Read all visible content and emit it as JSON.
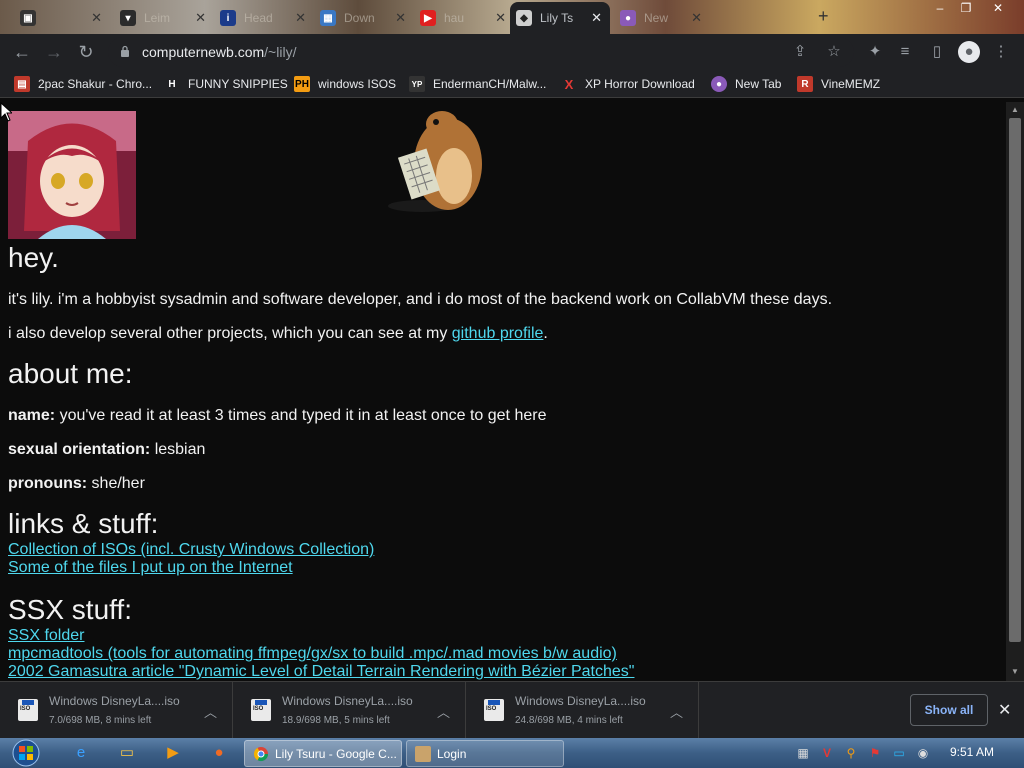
{
  "browser": {
    "tabs": [
      {
        "label": "",
        "favicon_text": "",
        "favicon_color": "#333333",
        "active": false
      },
      {
        "label": "Leim",
        "favicon_text": "",
        "favicon_color": "#2b2b2b",
        "active": false
      },
      {
        "label": "Head",
        "favicon_text": "i",
        "favicon_color": "#1b3b8a",
        "active": false
      },
      {
        "label": "Down",
        "favicon_text": "",
        "favicon_color": "#3a78c4",
        "active": false
      },
      {
        "label": "hau",
        "favicon_text": "▶",
        "favicon_color": "#e02020",
        "active": false
      },
      {
        "label": "Lily Ts",
        "favicon_text": "",
        "favicon_color": "#cfcfcf",
        "active": true
      },
      {
        "label": "New",
        "favicon_text": "",
        "favicon_color": "#8a5ab8",
        "active": false
      }
    ],
    "url_host": "computernewb.com",
    "url_path": "/~lily/"
  },
  "bookmarks": [
    {
      "label": "2pac Shakur - Chro...",
      "icon": "bookmark-2pac-icon",
      "icon_text": "",
      "icon_color": "#c0392b"
    },
    {
      "label": "FUNNY SNIPPIES",
      "icon": "letter-h-icon",
      "icon_text": "H",
      "icon_color": "#202124"
    },
    {
      "label": "windows ISOS",
      "icon": "ph-icon",
      "icon_text": "PH",
      "icon_color": "#f39c12"
    },
    {
      "label": "EndermanCH/Malw...",
      "icon": "yp-icon",
      "icon_text": "YP",
      "icon_color": "#333333"
    },
    {
      "label": "XP Horror Download",
      "icon": "x-icon",
      "icon_text": "X",
      "icon_color": "#202124"
    },
    {
      "label": "New Tab",
      "icon": "newtab-icon",
      "icon_text": "",
      "icon_color": "#8a5ab8"
    },
    {
      "label": "VineMEMZ",
      "icon": "r-icon",
      "icon_text": "R",
      "icon_color": "#c0392b"
    }
  ],
  "page": {
    "greeting": "hey.",
    "intro": "it's lily. i'm a hobbyist sysadmin and software developer, and i do most of the backend work on CollabVM these days.",
    "projects_prefix": "i also develop several other projects, which you can see at my ",
    "projects_link": "github profile",
    "projects_suffix": ".",
    "about_heading": "about me:",
    "name_label": "name:",
    "name_value": " you've read it at least 3 times and typed it in at least once to get here",
    "orientation_label": "sexual orientation:",
    "orientation_value": " lesbian",
    "pronouns_label": "pronouns:",
    "pronouns_value": " she/her",
    "links_heading": "links & stuff:",
    "links": [
      "Collection of ISOs (incl. Crusty Windows Collection)",
      "Some of the files I put up on the Internet"
    ],
    "ssx_heading": "SSX stuff:",
    "ssx_links": [
      "SSX folder",
      "mpcmadtools (tools for automating ffmpeg/gx/sx to build .mpc/.mad movies b/w audio)",
      "2002 Gamasutra article \"Dynamic Level of Detail Terrain Rendering with Bézier Patches\""
    ]
  },
  "downloads": {
    "items": [
      {
        "name": "Windows DisneyLa....iso",
        "status": "7.0/698 MB, 8 mins left"
      },
      {
        "name": "Windows DisneyLa....iso",
        "status": "18.9/698 MB, 5 mins left"
      },
      {
        "name": "Windows DisneyLa....iso",
        "status": "24.8/698 MB, 4 mins left"
      }
    ],
    "show_all": "Show all"
  },
  "taskbar": {
    "buttons": [
      {
        "label": "Lily Tsuru - Google C...",
        "active": true
      },
      {
        "label": "Login",
        "active": false
      }
    ],
    "clock": "9:51 AM"
  },
  "colors": {
    "link": "#4fd8ee",
    "page_bg": "#0c0c0c",
    "chrome_bg": "#202124"
  }
}
